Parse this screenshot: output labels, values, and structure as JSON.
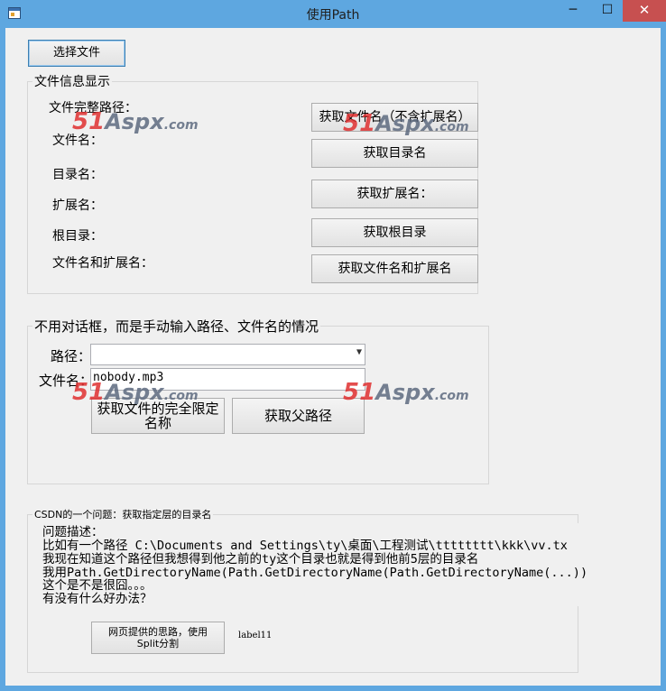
{
  "window": {
    "title": "使用Path",
    "minimize": "─",
    "maximize": "☐",
    "close": "✕"
  },
  "top": {
    "select_file_button": "选择文件"
  },
  "file_info": {
    "caption": "文件信息显示",
    "full_path_label": "文件完整路径：",
    "file_name_label": "文件名：",
    "dir_name_label": "目录名：",
    "ext_label": "扩展名：",
    "root_label": "根目录：",
    "name_ext_label": "文件名和扩展名：",
    "btn_name_no_ext": "获取文件名（不含扩展名）",
    "btn_dir_name": "获取目录名",
    "btn_ext": "获取扩展名：",
    "btn_root": "获取根目录",
    "btn_name_ext": "获取文件名和扩展名"
  },
  "manual": {
    "caption": "不用对话框，而是手动输入路径、文件名的情况",
    "path_label": "路径：",
    "path_value": "",
    "file_label": "文件名：",
    "file_value": "nobody.mp3",
    "btn_full_name": "获取文件的完全限定名称",
    "btn_parent": "获取父路径"
  },
  "csdn": {
    "caption": "CSDN的一个问题：获取指定层的目录名",
    "desc_lines": [
      "问题描述：",
      "比如有一个路径 C:\\Documents and Settings\\ty\\桌面\\工程测试\\tttttttt\\kkk\\vv.tx",
      "我现在知道这个路径但我想得到他之前的ty这个目录也就是得到他前5层的目录名",
      "我用Path.GetDirectoryName(Path.GetDirectoryName(Path.GetDirectoryName(...))",
      "这个是不是很囧。。。",
      "有没有什么好办法？"
    ],
    "btn_split": "网页提供的思路，使用Split分割",
    "label11": "label11"
  },
  "watermark": {
    "num": "51",
    "brand": "Aspx",
    "suffix": ".com"
  }
}
